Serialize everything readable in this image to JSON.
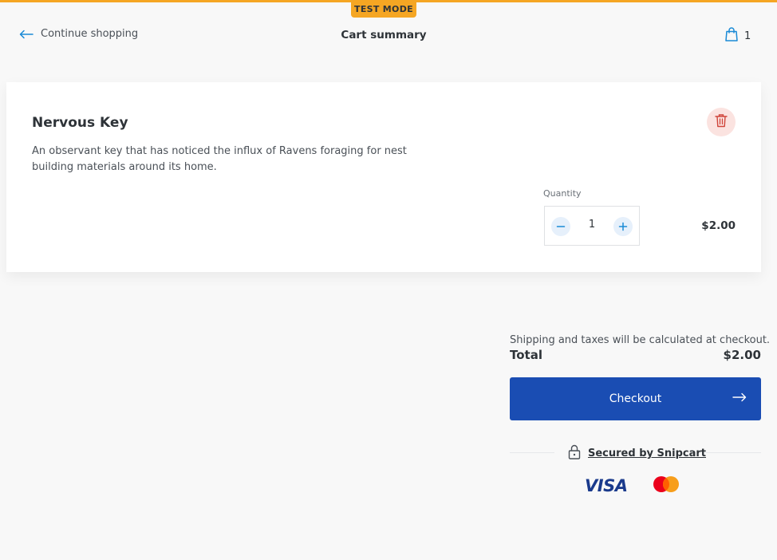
{
  "badge": {
    "label": "TEST MODE"
  },
  "header": {
    "continue_label": "Continue shopping",
    "title": "Cart summary",
    "cart_count": "1"
  },
  "item": {
    "name": "Nervous Key",
    "description": "An observant key that has noticed the influx of Ravens foraging for nest building materials around its home.",
    "quantity_label": "Quantity",
    "quantity": "1",
    "price": "$2.00"
  },
  "summary": {
    "shipping_note": "Shipping and taxes will be calculated at checkout.",
    "total_label": "Total",
    "total_value": "$2.00",
    "checkout_label": "Checkout",
    "secured_label": "Secured by Snipcart"
  },
  "payment": {
    "visa_label": "VISA",
    "mastercard_icon": "mastercard-logo"
  },
  "colors": {
    "accent": "#f5a623",
    "primary": "#1a4db3",
    "link": "#1a8ad6",
    "danger": "#d0453a"
  }
}
